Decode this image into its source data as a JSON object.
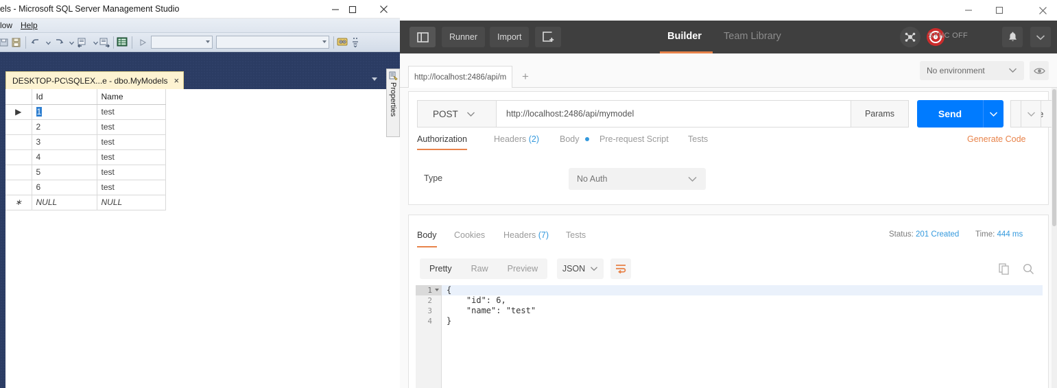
{
  "ssms": {
    "window_title": "els - Microsoft SQL Server Management Studio",
    "window_controls": {
      "minimize": "minimize-icon",
      "maximize": "maximize-icon",
      "close": "close-icon"
    },
    "menus": [
      {
        "label": "low"
      },
      {
        "label": "Help"
      }
    ],
    "toolbar_icons": [
      "save-icon",
      "undo-icon",
      "undo-dropdown-icon",
      "redo-icon",
      "redo-dropdown-icon",
      "new-query-icon",
      "new-query-dropdown-icon",
      "execute-query-icon",
      "design-query-icon",
      "run-icon",
      "show-diagram-icon",
      "sort-icon"
    ],
    "document_tab": {
      "label": "DESKTOP-PC\\SQLEX...e - dbo.MyModels",
      "close": "×"
    },
    "properties_tab": {
      "label": "Properties",
      "icon": "properties-icon"
    },
    "grid": {
      "columns": [
        "",
        "Id",
        "Name"
      ],
      "rows": [
        {
          "marker": "▶",
          "id": "1",
          "name": "test",
          "selected": true
        },
        {
          "marker": "",
          "id": "2",
          "name": "test",
          "selected": false
        },
        {
          "marker": "",
          "id": "3",
          "name": "test",
          "selected": false
        },
        {
          "marker": "",
          "id": "4",
          "name": "test",
          "selected": false
        },
        {
          "marker": "",
          "id": "5",
          "name": "test",
          "selected": false
        },
        {
          "marker": "",
          "id": "6",
          "name": "test",
          "selected": false
        },
        {
          "marker": "∗",
          "id": "NULL",
          "name": "NULL",
          "selected": false,
          "is_null": true
        }
      ]
    }
  },
  "postman": {
    "window_controls": {
      "minimize": "minimize-icon",
      "maximize": "maximize-icon",
      "close": "close-icon"
    },
    "toolbar": {
      "sidebar_toggle": "sidebar-toggle-icon",
      "runner_label": "Runner",
      "import_label": "Import",
      "new_tab_icon": "new-tab-icon",
      "nav": [
        {
          "label": "Builder",
          "active": true
        },
        {
          "label": "Team Library",
          "active": false
        }
      ],
      "scratchpad_icon": "scratchpad-icon",
      "sync_status": "SYNC OFF",
      "sync_icon": "sync-icon",
      "bell_icon": "bell-icon",
      "chevron_icon": "chevron-down-icon"
    },
    "tabbar": {
      "request_tab_label": "http://localhost:2486/api/m",
      "add_tab": "+",
      "environment": "No environment",
      "environment_chevron": "chevron-down-icon",
      "eye_icon": "eye-icon"
    },
    "request": {
      "method": "POST",
      "method_chevron": "chevron-down-icon",
      "url": "http://localhost:2486/api/mymodel",
      "params_label": "Params",
      "send_label": "Send",
      "send_chevron": "chevron-down-icon",
      "save_label": "Save",
      "save_chevron": "chevron-down-icon",
      "tabs": [
        {
          "label": "Authorization",
          "active": true,
          "count": "",
          "dot": false
        },
        {
          "label": "Headers",
          "active": false,
          "count": "(2)",
          "dot": false
        },
        {
          "label": "Body",
          "active": false,
          "count": "",
          "dot": true
        },
        {
          "label": "Pre-request Script",
          "active": false,
          "count": "",
          "dot": false
        },
        {
          "label": "Tests",
          "active": false,
          "count": "",
          "dot": false
        }
      ],
      "generate_code_label": "Generate Code"
    },
    "authorization": {
      "type_label": "Type",
      "type_value": "No Auth",
      "type_chevron": "chevron-down-icon"
    },
    "response": {
      "tabs": [
        {
          "label": "Body",
          "active": true,
          "count": ""
        },
        {
          "label": "Cookies",
          "active": false,
          "count": ""
        },
        {
          "label": "Headers",
          "active": false,
          "count": "(7)"
        },
        {
          "label": "Tests",
          "active": false,
          "count": ""
        }
      ],
      "status_label": "Status:",
      "status_value": "201 Created",
      "time_label": "Time:",
      "time_value": "444 ms",
      "format_buttons": [
        {
          "label": "Pretty",
          "active": true
        },
        {
          "label": "Raw",
          "active": false
        },
        {
          "label": "Preview",
          "active": false
        }
      ],
      "language": "JSON",
      "language_chevron": "chevron-down-icon",
      "wrap_icon": "word-wrap-icon",
      "copy_icon": "copy-icon",
      "search_icon": "search-icon",
      "body_lines": [
        {
          "num": "1",
          "fold": true,
          "text": "{"
        },
        {
          "num": "2",
          "fold": false,
          "text": "    \"id\": 6,"
        },
        {
          "num": "3",
          "fold": false,
          "text": "    \"name\": \"test\""
        },
        {
          "num": "4",
          "fold": false,
          "text": "}"
        }
      ]
    }
  },
  "colors": {
    "postman_toolbar_bg": "#3f3f3f",
    "accent_orange": "#e8834a",
    "send_blue": "#007bff",
    "status_blue": "#3399dd",
    "ssms_doc_bg": "#2b3c63",
    "ssms_tab_yellow": "#fdf3d2",
    "grid_selection_blue": "#2f7fd0",
    "sync_red": "#cc2c2c"
  }
}
